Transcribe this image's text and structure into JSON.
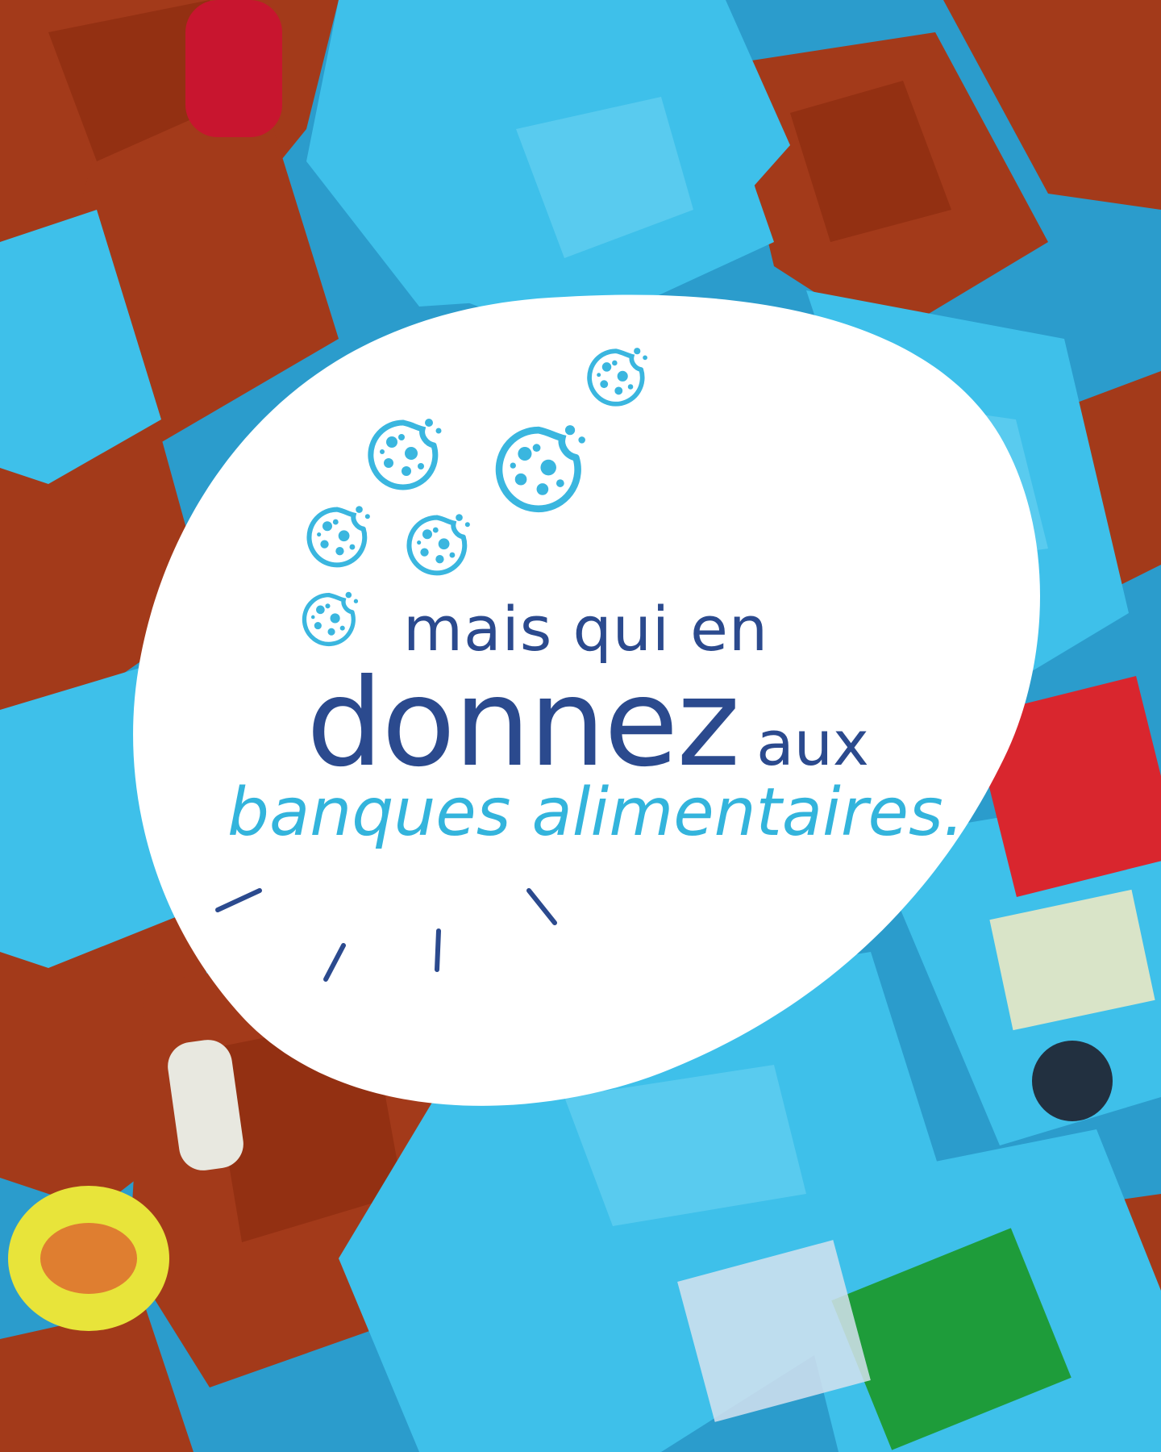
{
  "text": {
    "line1": "mais qui en",
    "line2_big": "donnez",
    "line2_small": "aux",
    "line3": "banques alimentaires."
  },
  "colors": {
    "navy_text": "#2b4a8e",
    "cyan_text": "#33b4dc",
    "cookie": "#3ab6df",
    "bag_cyan": "#3ec0ea",
    "bag_red": "#a63b1c",
    "blob": "#ffffff"
  },
  "icons": [
    "cookie-icon",
    "sparkle-lines-icon"
  ]
}
